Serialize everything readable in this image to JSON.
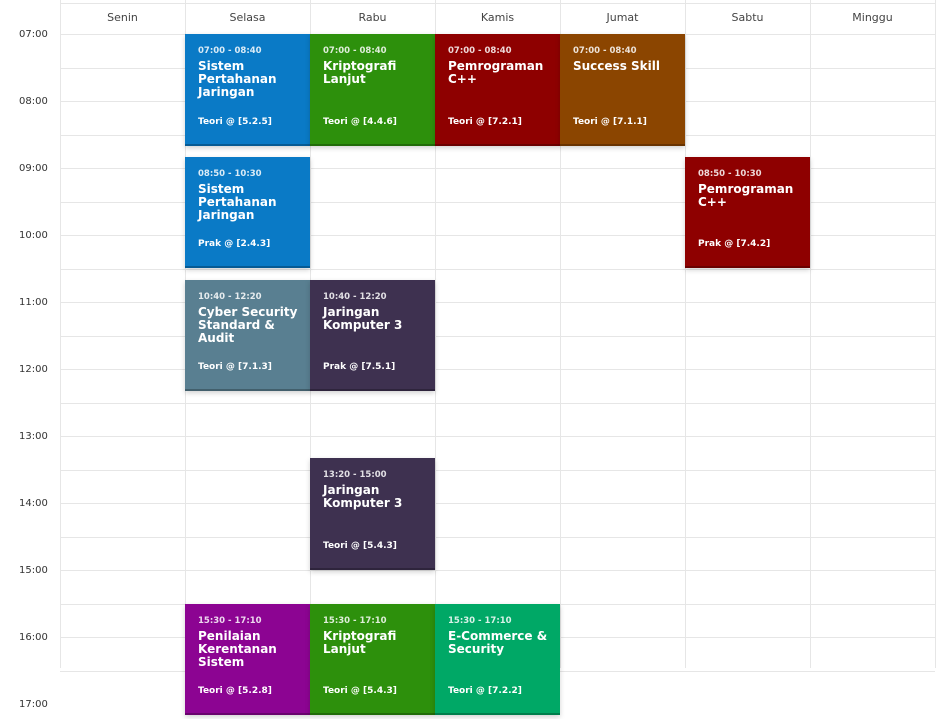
{
  "days": [
    "Senin",
    "Selasa",
    "Rabu",
    "Kamis",
    "Jumat",
    "Sabtu",
    "Minggu"
  ],
  "hours": [
    "07:00",
    "08:00",
    "09:00",
    "10:00",
    "11:00",
    "12:00",
    "13:00",
    "14:00",
    "15:00",
    "16:00",
    "17:00"
  ],
  "events": [
    {
      "day": 1,
      "start": "07:00",
      "end": "08:40",
      "time": "07:00 - 08:40",
      "title": "Sistem Pertahanan Jaringan",
      "location": "Teori @ [5.2.5]",
      "color": "#0a7ac6"
    },
    {
      "day": 2,
      "start": "07:00",
      "end": "08:40",
      "time": "07:00 - 08:40",
      "title": "Kriptografi Lanjut",
      "location": "Teori @ [4.4.6]",
      "color": "#2d900c"
    },
    {
      "day": 3,
      "start": "07:00",
      "end": "08:40",
      "time": "07:00 - 08:40",
      "title": "Pemrograman C++",
      "location": "Teori @ [7.2.1]",
      "color": "#8e0000"
    },
    {
      "day": 4,
      "start": "07:00",
      "end": "08:40",
      "time": "07:00 - 08:40",
      "title": "Success Skill",
      "location": "Teori @ [7.1.1]",
      "color": "#8b4500"
    },
    {
      "day": 1,
      "start": "08:50",
      "end": "10:30",
      "time": "08:50 - 10:30",
      "title": "Sistem Pertahanan Jaringan",
      "location": "Prak @ [2.4.3]",
      "color": "#0a7ac6"
    },
    {
      "day": 5,
      "start": "08:50",
      "end": "10:30",
      "time": "08:50 - 10:30",
      "title": "Pemrograman C++",
      "location": "Prak @ [7.4.2]",
      "color": "#8e0000"
    },
    {
      "day": 1,
      "start": "10:40",
      "end": "12:20",
      "time": "10:40 - 12:20",
      "title": "Cyber Security Standard & Audit",
      "location": "Teori @ [7.1.3]",
      "color": "#597f91"
    },
    {
      "day": 2,
      "start": "10:40",
      "end": "12:20",
      "time": "10:40 - 12:20",
      "title": "Jaringan Komputer 3",
      "location": "Prak @ [7.5.1]",
      "color": "#3e3150"
    },
    {
      "day": 2,
      "start": "13:20",
      "end": "15:00",
      "time": "13:20 - 15:00",
      "title": "Jaringan Komputer 3",
      "location": "Teori @ [5.4.3]",
      "color": "#3e3150"
    },
    {
      "day": 1,
      "start": "15:30",
      "end": "17:10",
      "time": "15:30 - 17:10",
      "title": "Penilaian Kerentanan Sistem",
      "location": "Teori @ [5.2.8]",
      "color": "#8c0492"
    },
    {
      "day": 2,
      "start": "15:30",
      "end": "17:10",
      "time": "15:30 - 17:10",
      "title": "Kriptografi Lanjut",
      "location": "Teori @ [5.4.3]",
      "color": "#2d900c"
    },
    {
      "day": 3,
      "start": "15:30",
      "end": "17:10",
      "time": "15:30 - 17:10",
      "title": "E-Commerce & Security",
      "location": "Teori @ [7.2.2]",
      "color": "#00a866"
    }
  ]
}
